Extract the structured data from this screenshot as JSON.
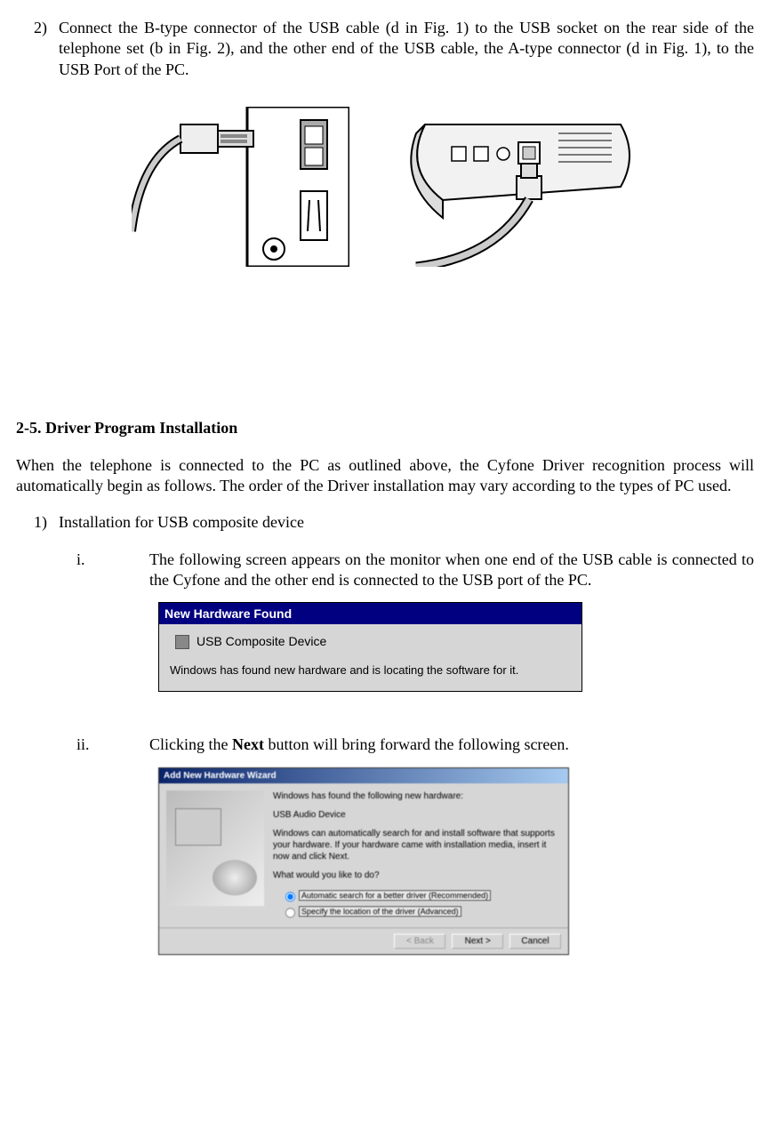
{
  "step2": {
    "number": "2)",
    "text": "Connect the B-type connector of the USB cable (d in Fig. 1) to the USB socket on the rear side of the telephone set (b in Fig. 2), and the other end of the USB cable, the A-type connector (d in Fig. 1), to the USB Port of the PC."
  },
  "section": {
    "heading": "2-5. Driver Program Installation",
    "intro": "When the telephone is connected to the PC as outlined above, the Cyfone Driver recognition process will automatically begin as follows.  The order of the Driver installation  may vary according to the types of PC used."
  },
  "step1": {
    "number": "1)",
    "text": "Installation for USB composite device"
  },
  "sub_i": {
    "roman": "i.",
    "text": "The following screen appears  on the monitor when  one end of the USB cable is connected to the Cyfone and the other end is connected to the USB port of the PC."
  },
  "hw_found": {
    "title": "New Hardware Found",
    "device": "USB Composite Device",
    "message": "Windows has found new hardware and is locating the software for it."
  },
  "sub_ii": {
    "roman": "ii.",
    "text_before": "Clicking the ",
    "bold": "Next",
    "text_after": " button will bring forward the following screen."
  },
  "wizard": {
    "title": "Add New Hardware Wizard",
    "line1": "Windows has found the following new hardware:",
    "device": "USB Audio Device",
    "line2": "Windows can automatically search for and install software that supports your hardware. If your hardware came with installation media, insert it now and click Next.",
    "question": "What would you like to do?",
    "opt1": "Automatic search for a better driver (Recommended)",
    "opt2": "Specify the location of the driver (Advanced)",
    "back": "< Back",
    "next": "Next >",
    "cancel": "Cancel"
  }
}
